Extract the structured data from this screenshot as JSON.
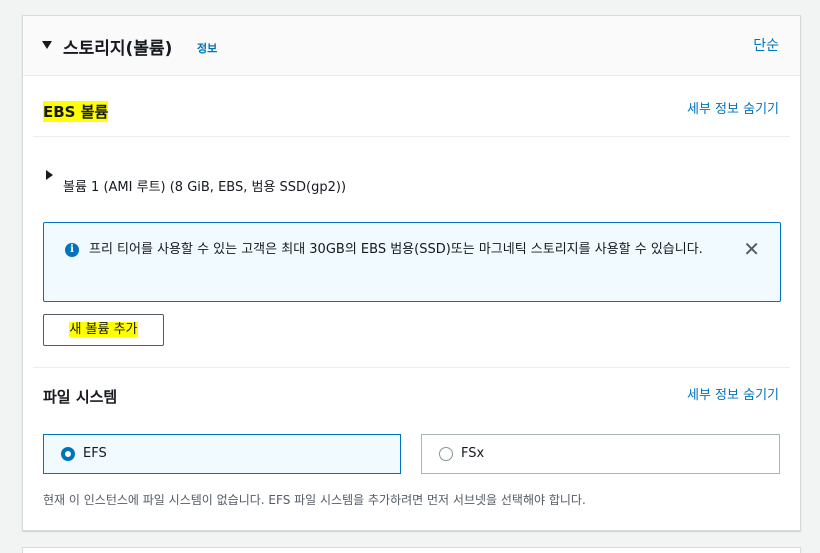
{
  "storage_panel": {
    "title": "스토리지(볼륨)",
    "info_link": "정보",
    "simple_link": "단순"
  },
  "ebs_section": {
    "title": "EBS 볼륨",
    "details_link": "세부 정보 숨기기",
    "volume_label": "볼륨 1 (AMI 루트) (8 GiB, EBS, 범용 SSD(gp2))",
    "alert_text": "프리 티어를 사용할 수 있는 고객은 최대 30GB의 EBS 범용(SSD)또는 마그네틱 스토리지를 사용할 수 있습니다.",
    "add_volume_button": "새 볼륨 추가"
  },
  "file_system_section": {
    "title": "파일 시스템",
    "details_link": "세부 정보 숨기기",
    "options": [
      {
        "label": "EFS",
        "selected": true
      },
      {
        "label": "FSx",
        "selected": false
      }
    ],
    "description": "현재 이 인스턴스에 파일 시스템이 없습니다. EFS 파일 시스템을 추가하려면 먼저 서브넷을 선택해야 합니다."
  },
  "colors": {
    "link": "#0073bb",
    "highlight": "#ffff00",
    "alert_bg": "#f1faff"
  },
  "icons": [
    "caret-down-icon",
    "caret-right-icon",
    "info-icon",
    "close-icon"
  ]
}
